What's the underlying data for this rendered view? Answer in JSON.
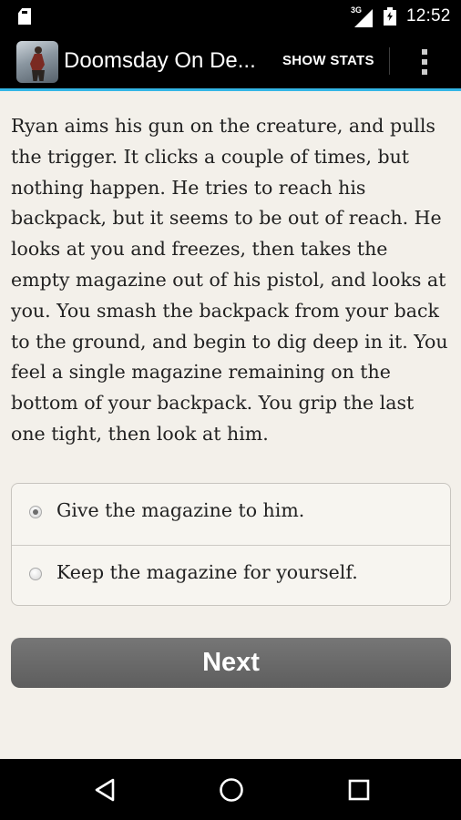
{
  "status_bar": {
    "network_label": "3G",
    "time": "12:52"
  },
  "action_bar": {
    "title": "Doomsday On De...",
    "show_stats_label": "SHOW STATS",
    "accent_color": "#33b5e5"
  },
  "story": {
    "text": "Ryan aims his gun on the creature, and pulls the trigger. It clicks a couple of times, but nothing happen. He tries to reach his backpack, but it seems to be out of reach. He looks at you and freezes, then takes the empty magazine out of his pistol, and looks at you. You smash the backpack from your back to the ground, and begin to dig deep in it. You feel a single magazine remaining on the bottom of your backpack. You grip the last one tight, then look at him."
  },
  "choices": [
    {
      "label": "Give the magazine to him.",
      "selected": true
    },
    {
      "label": "Keep the magazine for yourself.",
      "selected": false
    }
  ],
  "next_button": {
    "label": "Next"
  },
  "icons": {
    "sd_card": "sd-card-icon",
    "signal": "signal-icon",
    "battery": "battery-charging-icon",
    "overflow": "more-vertical-icon",
    "back": "back-icon",
    "home": "home-icon",
    "recents": "recents-icon"
  }
}
